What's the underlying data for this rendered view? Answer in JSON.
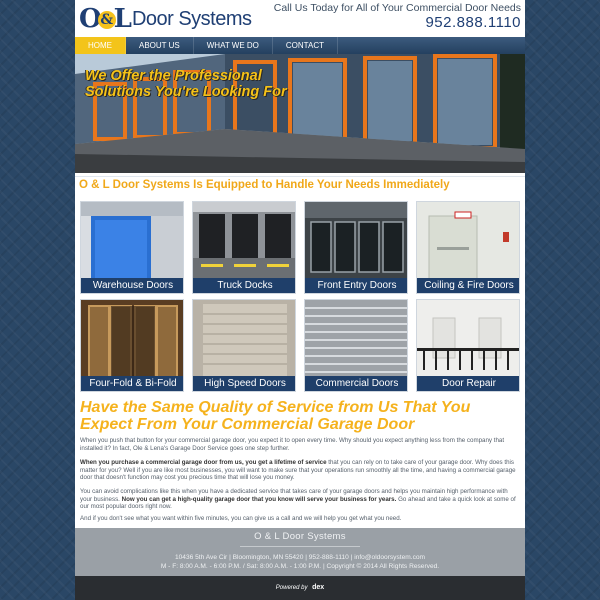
{
  "header": {
    "logo_mark_left": "O",
    "logo_amp": "&",
    "logo_mark_right": "L",
    "logo_text": "Door Systems",
    "call_text": "Call Us Today for All of Your Commercial Door Needs",
    "phone": "952.888.1110"
  },
  "nav": {
    "items": [
      {
        "label": "HOME",
        "active": true
      },
      {
        "label": "ABOUT US"
      },
      {
        "label": "WHAT WE DO"
      },
      {
        "label": "CONTACT"
      }
    ]
  },
  "hero": {
    "line1": "We Offer the Professional",
    "line2": "Solutions You're Looking For"
  },
  "services": {
    "heading": "O & L Door Systems Is Equipped to Handle Your Needs Immediately",
    "tiles": [
      {
        "label": "Warehouse Doors"
      },
      {
        "label": "Truck Docks"
      },
      {
        "label": "Front Entry Doors"
      },
      {
        "label": "Coiling & Fire Doors"
      },
      {
        "label": "Four-Fold & Bi-Fold"
      },
      {
        "label": "High Speed Doors"
      },
      {
        "label": "Commercial Doors"
      },
      {
        "label": "Door Repair"
      }
    ]
  },
  "content": {
    "heading": "Have the Same Quality of Service from Us That You Expect From Your Commercial Garage Door",
    "p1": "When you push that button for your commercial garage door, you expect it to open every time. Why should you expect anything less from the company that installed it? In fact, Ole & Lena's Garage Door Service goes one step further.",
    "p2_bold": "When you purchase a commercial garage door from us, you get a lifetime of service",
    "p2_rest": " that you can rely on to take care of your garage door. Why does this matter for you? Well if you are like most businesses, you will want to make sure that your operations run smoothly all the time, and having a commercial garage door that doesn't function may cost you precious time that will lose you money.",
    "p3_start": "You can avoid complications like this when you have a dedicated service that takes care of your garage doors and helps you maintain high performance with your business. ",
    "p3_bold": "Now you can get a high-quality garage door that you know will serve your business for years.",
    "p3_end": " Go ahead and take a quick look at some of our most popular doors right now.",
    "p4": "And if you don't see what you want within five minutes, you can give us a call and we will help you get what you need."
  },
  "footer": {
    "title": "O & L Door Systems",
    "address": "10436 5th Ave Cir | Bloomington, MN 55420 | 952-888-1110 | info@oldoorsystem.com",
    "hours": "M - F: 8:00 A.M. - 6:00 P.M. / Sat: 8:00 A.M. - 1:00 P.M. | Copyright © 2014 All Rights Reserved.",
    "powered_by": "Powered by",
    "powered_logo": "dex"
  }
}
